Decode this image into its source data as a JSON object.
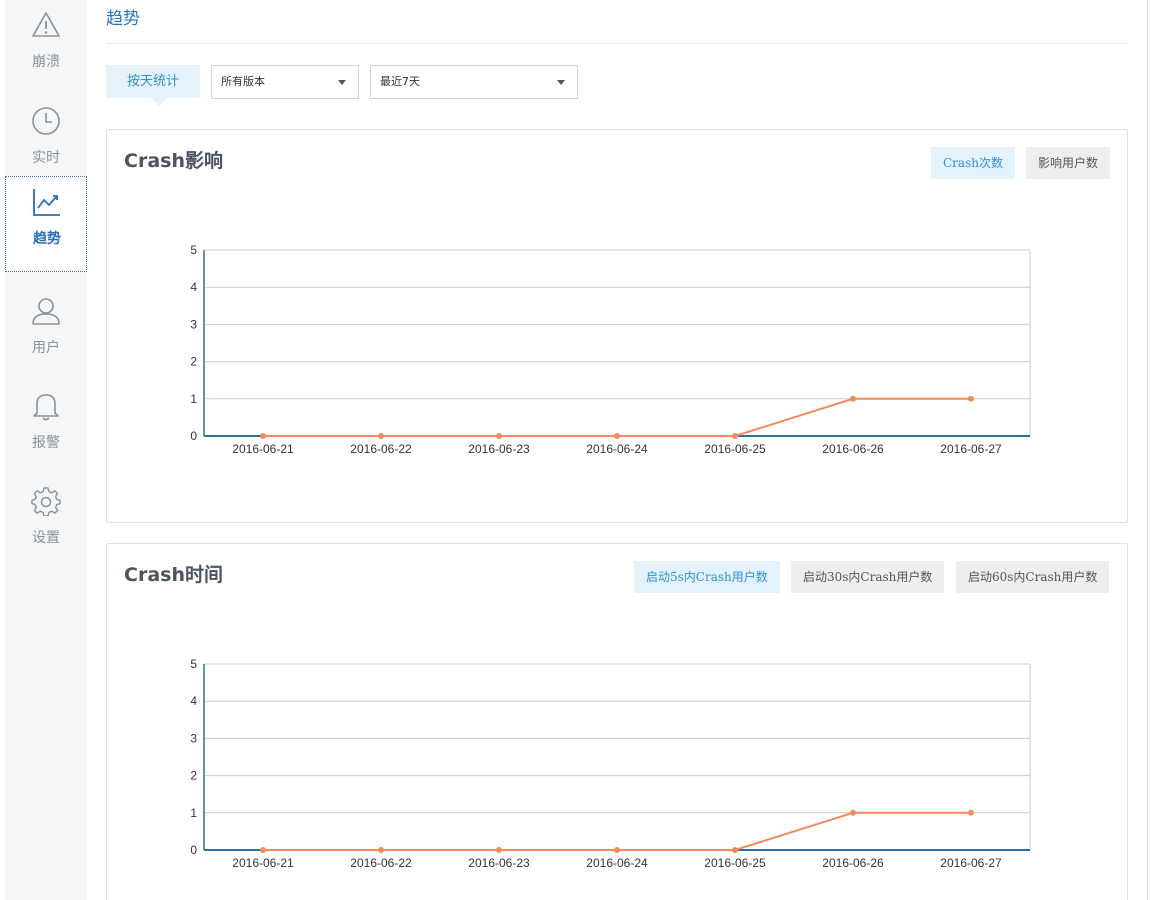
{
  "sidebar": {
    "items": [
      {
        "label": "崩溃",
        "icon": "warning-icon"
      },
      {
        "label": "实时",
        "icon": "clock-icon"
      },
      {
        "label": "趋势",
        "icon": "trend-chart-icon",
        "active": true
      },
      {
        "label": "用户",
        "icon": "user-icon"
      },
      {
        "label": "报警",
        "icon": "bell-icon"
      },
      {
        "label": "设置",
        "icon": "gear-icon"
      }
    ]
  },
  "page": {
    "title": "趋势"
  },
  "filters": {
    "by_day": "按天统计",
    "version": "所有版本",
    "range": "最近7天"
  },
  "panels": [
    {
      "title": "Crash影响",
      "toggles": [
        {
          "label": "Crash次数",
          "active": true
        },
        {
          "label": "影响用户数",
          "active": false
        }
      ]
    },
    {
      "title": "Crash时间",
      "toggles": [
        {
          "label": "启动5s内Crash用户数",
          "active": true
        },
        {
          "label": "启动30s内Crash用户数",
          "active": false
        },
        {
          "label": "启动60s内Crash用户数",
          "active": false
        }
      ]
    }
  ],
  "colors": {
    "accent": "#2a74c0",
    "line": "#f28a5c",
    "axis": "#2b6f9e"
  },
  "chart_data": [
    {
      "type": "line",
      "categories": [
        "2016-06-21",
        "2016-06-22",
        "2016-06-23",
        "2016-06-24",
        "2016-06-25",
        "2016-06-26",
        "2016-06-27"
      ],
      "values": [
        0,
        0,
        0,
        0,
        0,
        1,
        1
      ],
      "yticks": [
        0,
        1,
        2,
        3,
        4,
        5
      ],
      "ylim": [
        0,
        5
      ],
      "grid": true
    },
    {
      "type": "line",
      "categories": [
        "2016-06-21",
        "2016-06-22",
        "2016-06-23",
        "2016-06-24",
        "2016-06-25",
        "2016-06-26",
        "2016-06-27"
      ],
      "values": [
        0,
        0,
        0,
        0,
        0,
        1,
        1
      ],
      "yticks": [
        0,
        1,
        2,
        3,
        4,
        5
      ],
      "ylim": [
        0,
        5
      ],
      "grid": true
    }
  ]
}
